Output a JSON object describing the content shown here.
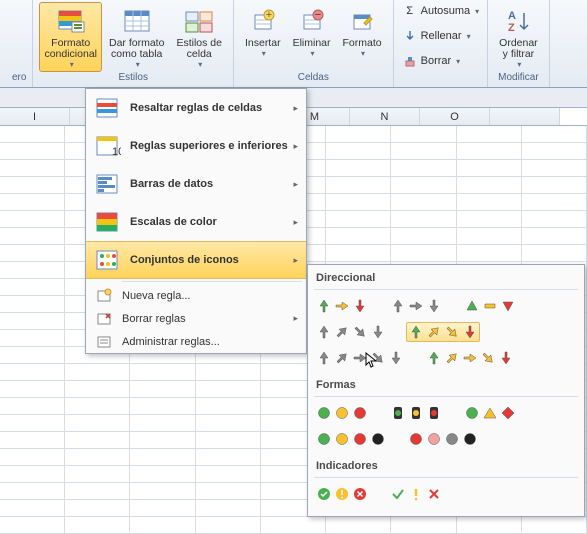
{
  "ribbon": {
    "formato_condicional": "Formato\ncondicional",
    "dar_formato": "Dar formato\ncomo tabla",
    "estilos_celda": "Estilos de\ncelda",
    "group_estilos": "Estilos",
    "insertar": "Insertar",
    "eliminar": "Eliminar",
    "formato": "Formato",
    "group_celdas": "Celdas",
    "autosuma": "Autosuma",
    "rellenar": "Rellenar",
    "borrar": "Borrar",
    "ordenar": "Ordenar\ny filtrar",
    "group_modificar": "Modificar",
    "zero_label": "ero"
  },
  "columns": [
    "I",
    "",
    "",
    "",
    "M",
    "N",
    "O",
    ""
  ],
  "menu": {
    "resaltar": "Resaltar reglas de celdas",
    "superiores": "Reglas superiores e inferiores",
    "barras": "Barras de datos",
    "escalas": "Escalas de color",
    "conjuntos": "Conjuntos de iconos",
    "nueva": "Nueva regla...",
    "borrar": "Borrar reglas",
    "administrar": "Administrar reglas..."
  },
  "submenu": {
    "direccional": "Direccional",
    "formas": "Formas",
    "indicadores": "Indicadores"
  }
}
